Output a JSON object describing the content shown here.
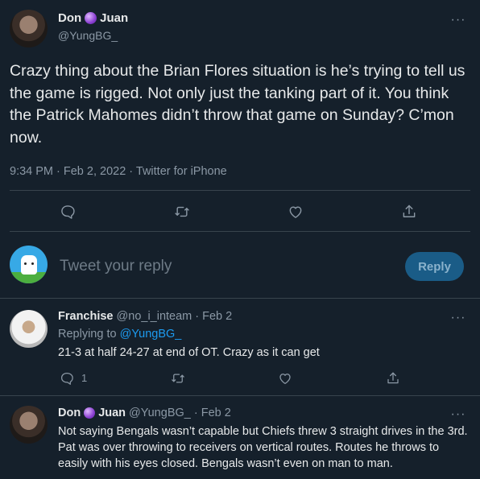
{
  "main_tweet": {
    "name_part1": "Don",
    "name_part2": "Juan",
    "handle": "@YungBG_",
    "text": "Crazy thing about the Brian Flores situation is he’s trying to tell us the game is rigged. Not only just the tanking part of it. You think the Patrick Mahomes didn’t throw that game on Sunday? C’mon now.",
    "time": "9:34 PM · Feb 2, 2022 · ",
    "source": "Twitter for iPhone"
  },
  "composer": {
    "placeholder": "Tweet your reply",
    "button_label": "Reply"
  },
  "replies": [
    {
      "name": "Franchise",
      "handle_time": "@no_i_inteam · Feb 2",
      "replying_to_label": "Replying to ",
      "replying_to_handle": "@YungBG_",
      "text": "21-3 at half 24-27 at end of OT. Crazy as it can get",
      "reply_count": "1"
    },
    {
      "name_part1": "Don",
      "name_part2": "Juan",
      "handle_time": "@YungBG_ · Feb 2",
      "text": "Not saying Bengals wasn’t capable but Chiefs threw 3 straight drives in the 3rd. Pat was over throwing to receivers on vertical routes. Routes he throws to easily with his eyes closed. Bengals wasn’t even on man to man."
    }
  ],
  "icons": {
    "more": "more-icon",
    "reply": "reply-icon",
    "retweet": "retweet-icon",
    "like": "like-icon",
    "share": "share-icon",
    "crystal_ball": "crystal-ball-emoji"
  },
  "colors": {
    "background": "#15202b",
    "accent": "#1d9bf0",
    "divider": "#38444d",
    "muted_text": "#8b98a5"
  }
}
